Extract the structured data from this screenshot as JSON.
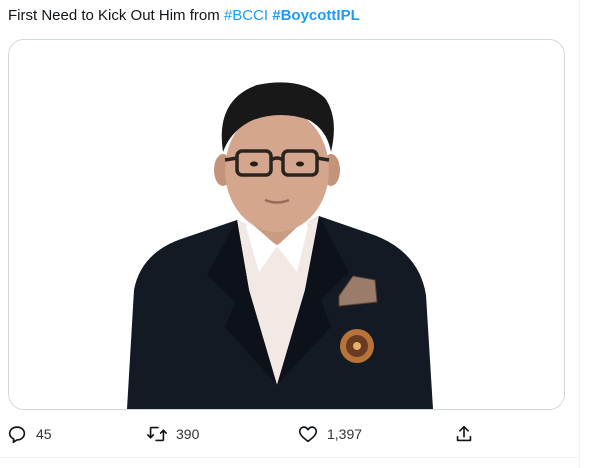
{
  "tweet": {
    "text": "First Need to Kick Out Him from ",
    "hashtag1": "#BCCI",
    "hashtag2": "#BoycottIPL"
  },
  "media": {
    "alt": "Photo of a man in glasses wearing a dark blazer with a BCCI crest and pocket square"
  },
  "actions": {
    "reply_icon": "reply-icon",
    "reply_count": "45",
    "retweet_icon": "retweet-icon",
    "retweet_count": "390",
    "like_icon": "heart-icon",
    "like_count": "1,397",
    "share_icon": "share-icon"
  },
  "colors": {
    "hashtag": "#1d9bf0",
    "icon": "#536471",
    "border": "#cfd9de"
  }
}
